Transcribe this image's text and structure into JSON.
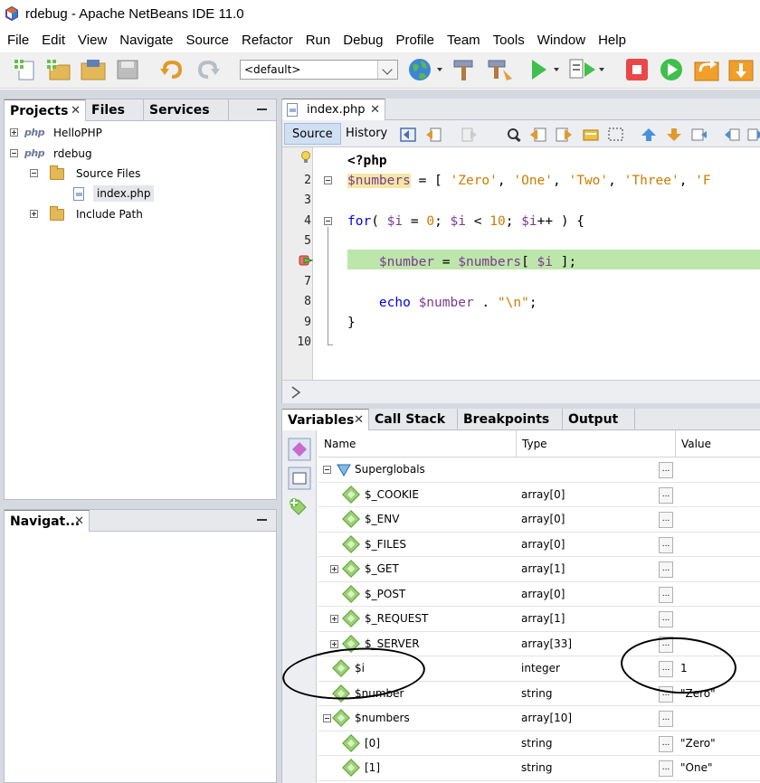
{
  "window": {
    "title": "rdebug - Apache NetBeans IDE 11.0"
  },
  "menu": [
    "File",
    "Edit",
    "View",
    "Navigate",
    "Source",
    "Refactor",
    "Run",
    "Debug",
    "Profile",
    "Team",
    "Tools",
    "Window",
    "Help"
  ],
  "toolbar": {
    "config_value": "<default>"
  },
  "projects_panel": {
    "tabs": [
      "Projects",
      "Files",
      "Services"
    ],
    "tree": [
      {
        "label": "HelloPHP",
        "type": "php-project"
      },
      {
        "label": "rdebug",
        "type": "php-project"
      },
      {
        "label": "Source Files",
        "type": "folder"
      },
      {
        "label": "index.php",
        "type": "php-file"
      },
      {
        "label": "Include Path",
        "type": "folder"
      }
    ]
  },
  "navigator_panel": {
    "tab": "Navigat..."
  },
  "editor": {
    "tab": "index.php",
    "subtabs": [
      "Source",
      "History"
    ],
    "line_numbers": [
      "",
      "2",
      "3",
      "4",
      "5",
      "",
      "7",
      "8",
      "9",
      "10"
    ]
  },
  "debugger_panel": {
    "tabs": [
      "Variables",
      "Call Stack",
      "Breakpoints",
      "Output"
    ],
    "columns": [
      "Name",
      "Type",
      "Value"
    ],
    "rows": [
      {
        "name": "Superglobals",
        "type": "",
        "value": ""
      },
      {
        "name": "$_COOKIE",
        "type": "array[0]",
        "value": ""
      },
      {
        "name": "$_ENV",
        "type": "array[0]",
        "value": ""
      },
      {
        "name": "$_FILES",
        "type": "array[0]",
        "value": ""
      },
      {
        "name": "$_GET",
        "type": "array[1]",
        "value": ""
      },
      {
        "name": "$_POST",
        "type": "array[0]",
        "value": ""
      },
      {
        "name": "$_REQUEST",
        "type": "array[1]",
        "value": ""
      },
      {
        "name": "$_SERVER",
        "type": "array[33]",
        "value": ""
      },
      {
        "name": "$i",
        "type": "integer",
        "value": "1"
      },
      {
        "name": "$number",
        "type": "string",
        "value": "\"Zero\""
      },
      {
        "name": "$numbers",
        "type": "array[10]",
        "value": ""
      },
      {
        "name": "[0]",
        "type": "string",
        "value": "\"Zero\""
      },
      {
        "name": "[1]",
        "type": "string",
        "value": "\"One\""
      }
    ]
  }
}
